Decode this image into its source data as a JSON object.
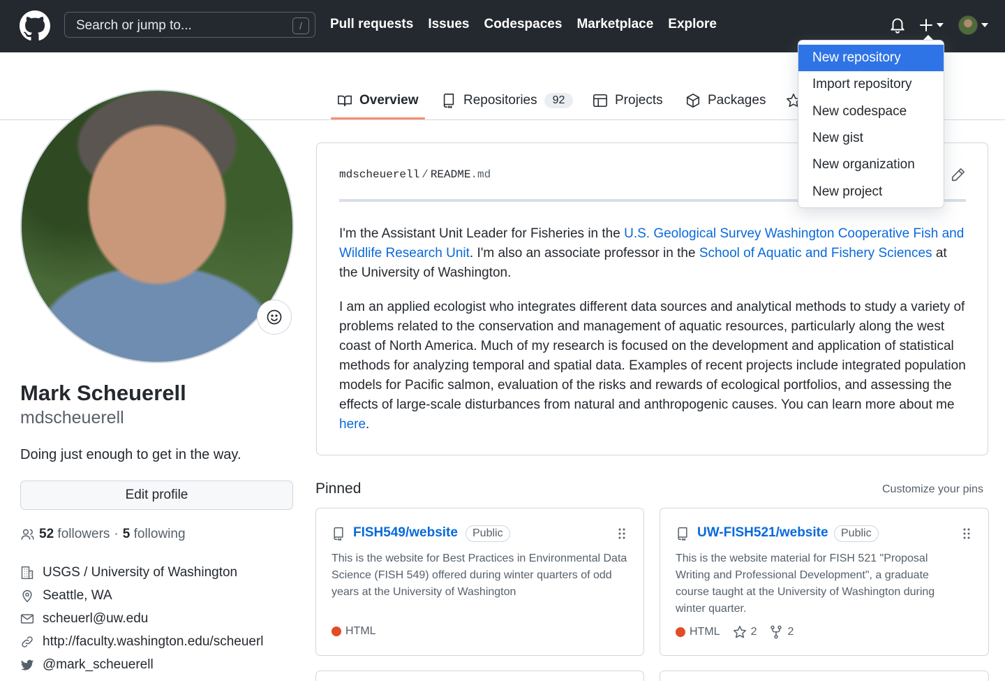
{
  "header": {
    "search_placeholder": "Search or jump to...",
    "search_shortcut": "/",
    "nav": [
      "Pull requests",
      "Issues",
      "Codespaces",
      "Marketplace",
      "Explore"
    ]
  },
  "create_menu": {
    "items": [
      "New repository",
      "Import repository",
      "New codespace",
      "New gist",
      "New organization",
      "New project"
    ],
    "highlighted": "New repository"
  },
  "tabs": {
    "overview": "Overview",
    "repositories": "Repositories",
    "repositories_count": "92",
    "projects": "Projects",
    "packages": "Packages"
  },
  "profile": {
    "name": "Mark Scheuerell",
    "login": "mdscheuerell",
    "bio": "Doing just enough to get in the way.",
    "edit_button": "Edit profile",
    "followers_count": "52",
    "followers_label": "followers",
    "separator": "·",
    "following_count": "5",
    "following_label": "following",
    "organization": "USGS / University of Washington",
    "location": "Seattle, WA",
    "email": "scheuerl@uw.edu",
    "website": "http://faculty.washington.edu/scheuerl",
    "twitter": "@mark_scheuerell"
  },
  "readme": {
    "owner": "mdscheuerell",
    "path_sep": "/",
    "file": "README",
    "ext": ".md",
    "p1": {
      "t1": "I'm the Assistant Unit Leader for Fisheries in the ",
      "link1": "U.S. Geological Survey Washington Cooperative Fish and Wildlife Research Unit",
      "t2": ". I'm also an associate professor in the ",
      "link2": "School of Aquatic and Fishery Sciences",
      "t3": " at the University of Washington."
    },
    "p2": {
      "t1": "I am an applied ecologist who integrates different data sources and analytical methods to study a variety of problems related to the conservation and management of aquatic resources, particularly along the west coast of North America. Much of my research is focused on the development and application of statistical methods for analyzing temporal and spatial data. Examples of recent projects include integrated population models for Pacific salmon, evaluation of the risks and rewards of ecological portfolios, and assessing the effects of large-scale disturbances from natural and anthropogenic causes. You can learn more about me ",
      "link": "here",
      "t2": "."
    }
  },
  "pinned": {
    "heading": "Pinned",
    "customize": "Customize your pins",
    "repos": [
      {
        "name": "FISH549/website",
        "visibility": "Public",
        "description": "This is the website for Best Practices in Environmental Data Science (FISH 549) offered during winter quarters of odd years at the University of Washington",
        "language": "HTML",
        "language_color": "#e34c26"
      },
      {
        "name": "UW-FISH521/website",
        "visibility": "Public",
        "description": "This is the website material for FISH 521 \"Proposal Writing and Professional Development\", a graduate course taught at the University of Washington during winter quarter.",
        "language": "HTML",
        "language_color": "#e34c26",
        "stars": "2",
        "forks": "2"
      }
    ]
  },
  "colors": {
    "header_bg": "#24292f",
    "link": "#0969da",
    "tab_underline": "#fd8c73",
    "menu_highlight": "#2f74e6"
  }
}
